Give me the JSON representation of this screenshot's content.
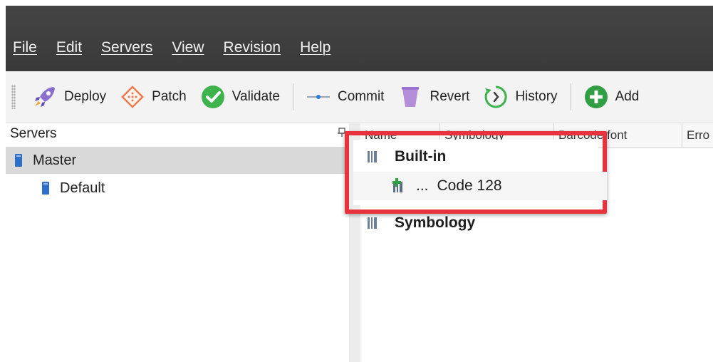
{
  "menu": {
    "items": [
      {
        "label": "File"
      },
      {
        "label": "Edit"
      },
      {
        "label": "Servers"
      },
      {
        "label": "View"
      },
      {
        "label": "Revision"
      },
      {
        "label": "Help"
      }
    ]
  },
  "toolbar": {
    "deploy": "Deploy",
    "patch": "Patch",
    "validate": "Validate",
    "commit": "Commit",
    "revert": "Revert",
    "history": "History",
    "add": "Add"
  },
  "servers_panel": {
    "title": "Servers",
    "items": [
      {
        "label": "Master",
        "selected": true
      },
      {
        "label": "Default",
        "selected": false
      }
    ]
  },
  "grid": {
    "columns": [
      "Name",
      "Symbology",
      "Barcode font",
      "Erro"
    ],
    "groups": [
      {
        "label": "Built-in",
        "children": [
          {
            "prefix": "...",
            "label": "Code 128"
          }
        ]
      },
      {
        "label": "Symbology",
        "children": []
      }
    ]
  },
  "colors": {
    "titlebar": "#3e3e3e",
    "highlight": "#e8333c",
    "validate_green": "#3cb44b",
    "add_green": "#2f9e44",
    "revert_purple": "#b48ddb"
  }
}
